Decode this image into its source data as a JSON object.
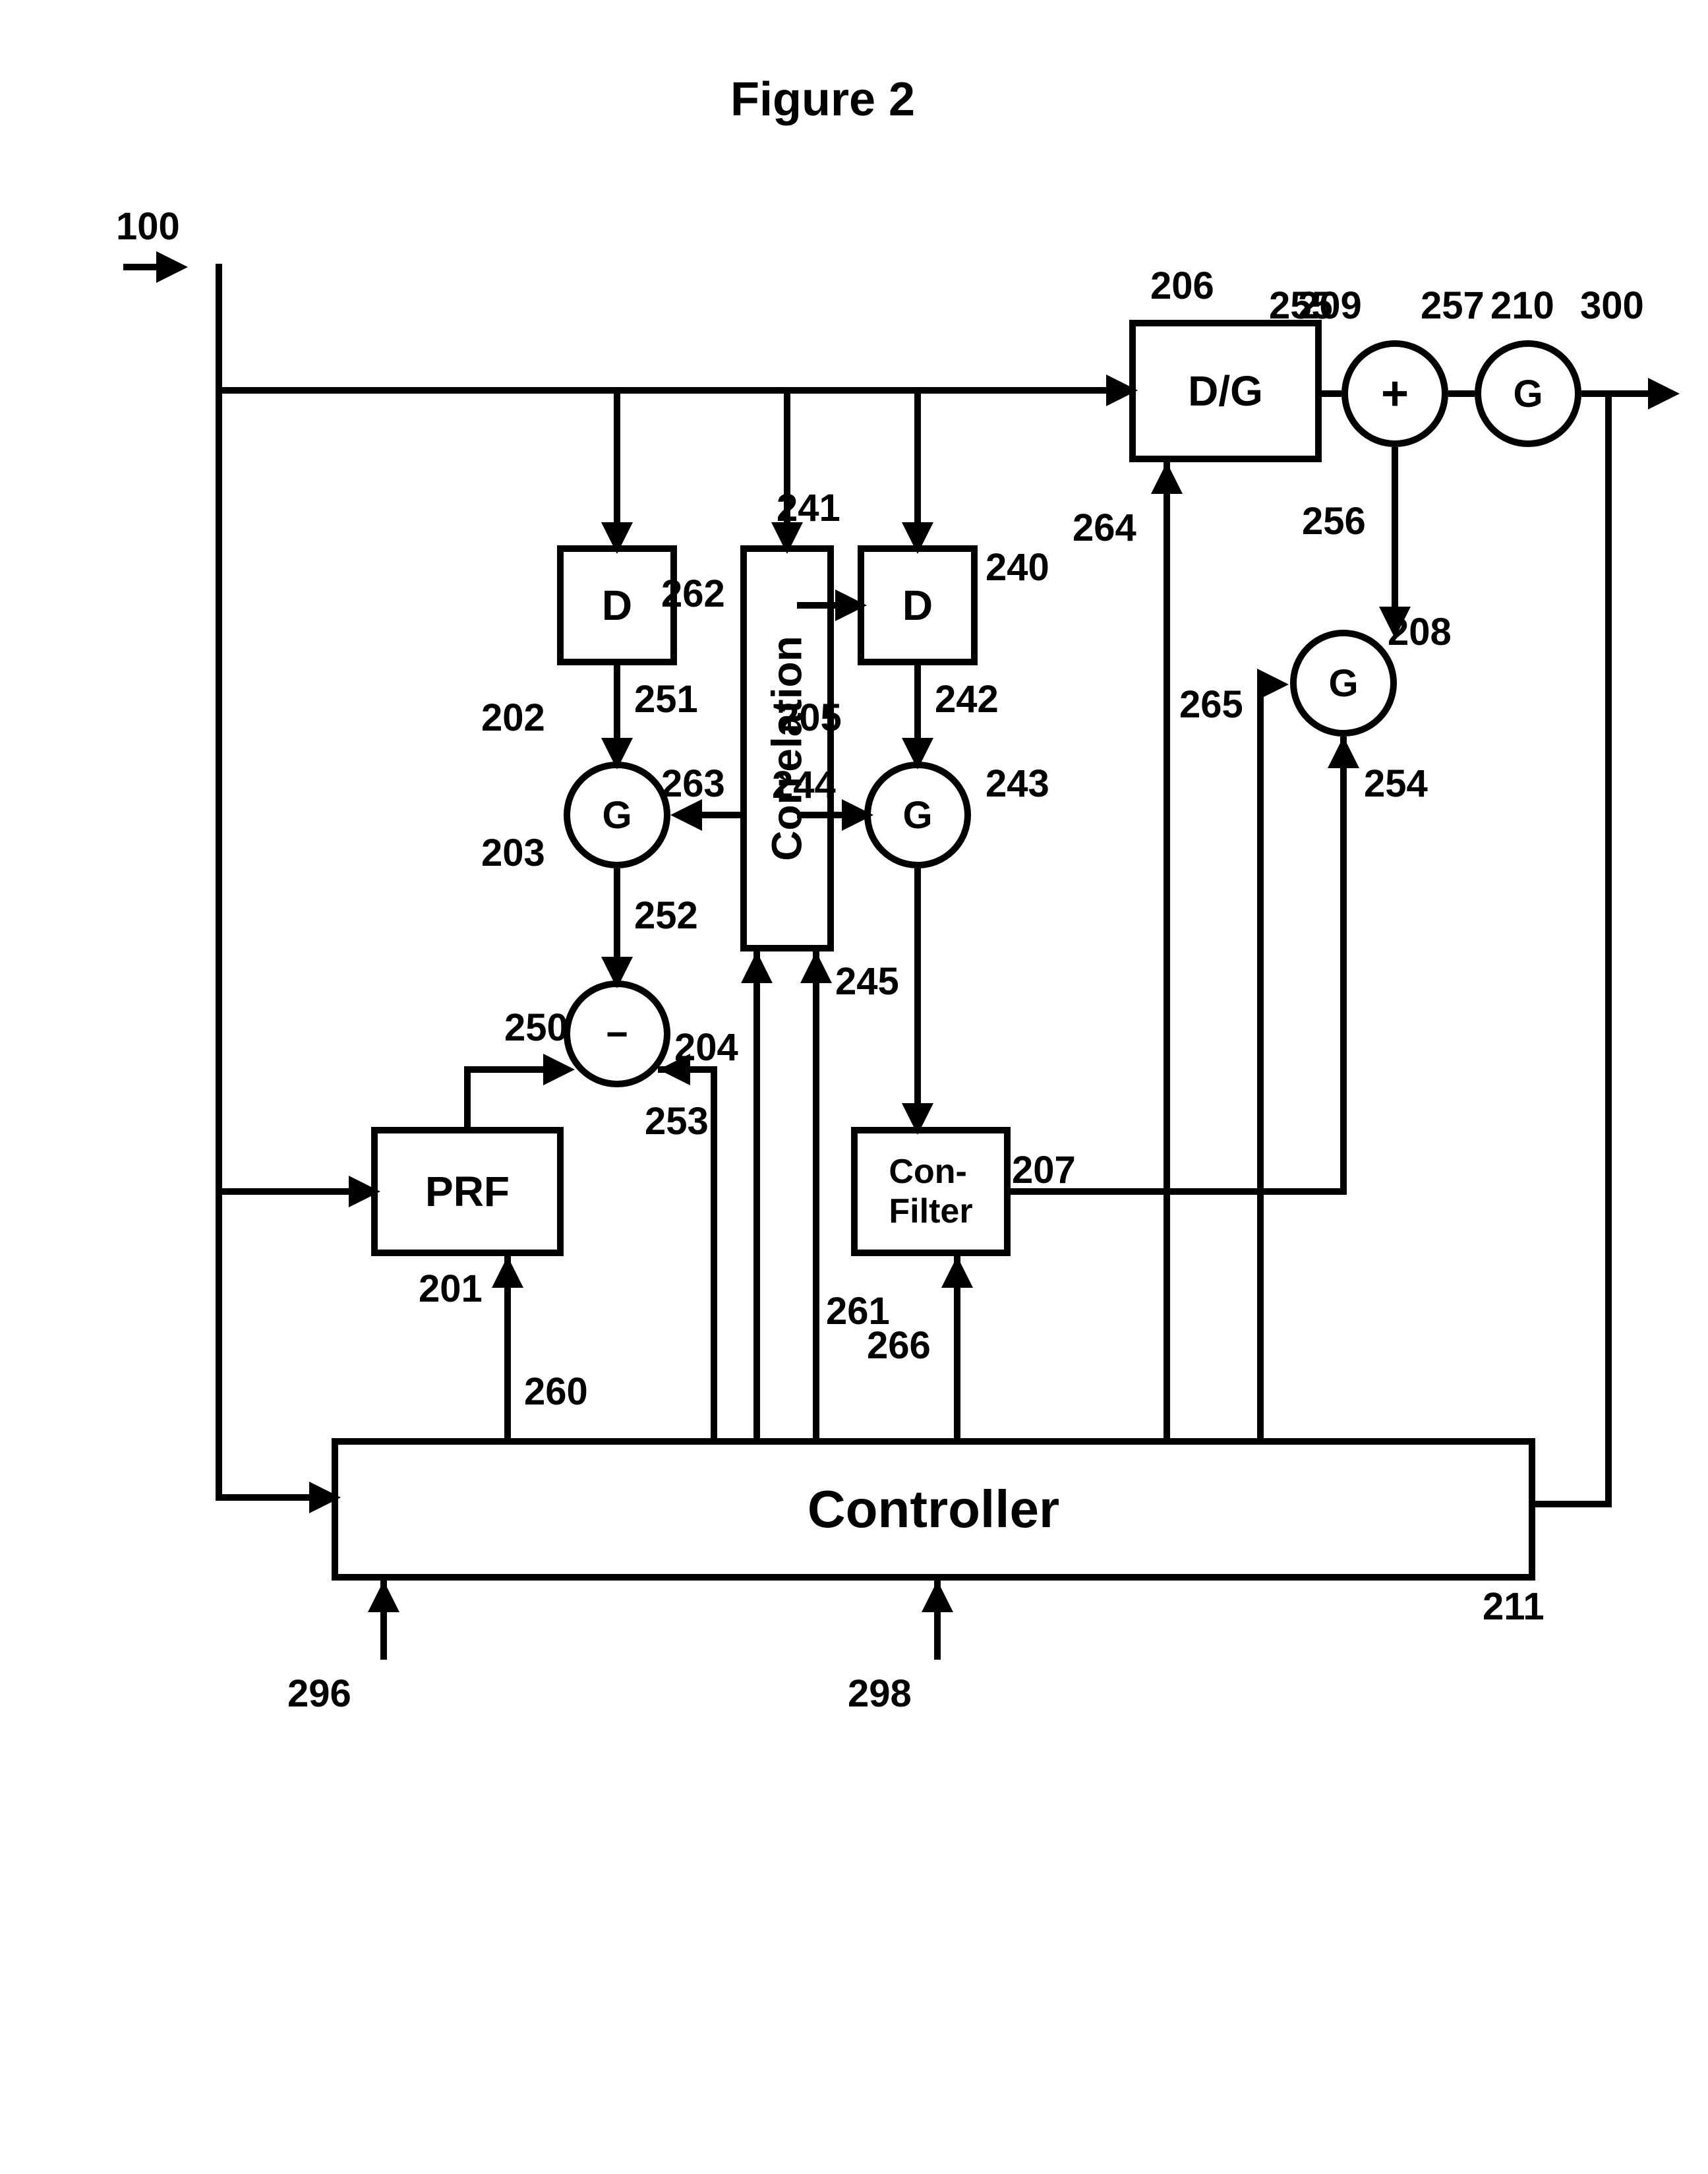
{
  "title": "Figure 2",
  "blocks": {
    "b201": {
      "text": "PRF",
      "ref": "201"
    },
    "b202": {
      "text": "D",
      "ref": "202"
    },
    "b240": {
      "text": "D",
      "ref": "240"
    },
    "b205": {
      "text": "Correlation",
      "ref": "205"
    },
    "b206": {
      "text": "D/G",
      "ref": "206"
    },
    "b207": {
      "text": "Con-\nFilter",
      "ref": "207"
    },
    "b211": {
      "text": "Controller",
      "ref": "211"
    }
  },
  "circles": {
    "c203": {
      "text": "G",
      "ref": "203"
    },
    "c243": {
      "text": "G",
      "ref": "243"
    },
    "c204": {
      "text": "−",
      "ref": "204"
    },
    "c209": {
      "text": "+",
      "ref": "209"
    },
    "c208": {
      "text": "G",
      "ref": "208"
    },
    "c210": {
      "text": "G",
      "ref": "210"
    }
  },
  "signals": {
    "s100": "100",
    "s300": "300",
    "s250": "250",
    "s251": "251",
    "s252": "252",
    "s253": "253",
    "s254": "254",
    "s255": "255",
    "s256": "256",
    "s257": "257",
    "s241": "241",
    "s242": "242",
    "s244": "244",
    "s245": "245",
    "s260": "260",
    "s261": "261",
    "s262": "262",
    "s263": "263",
    "s264": "264",
    "s265": "265",
    "s266": "266",
    "s296": "296",
    "s298": "298"
  }
}
